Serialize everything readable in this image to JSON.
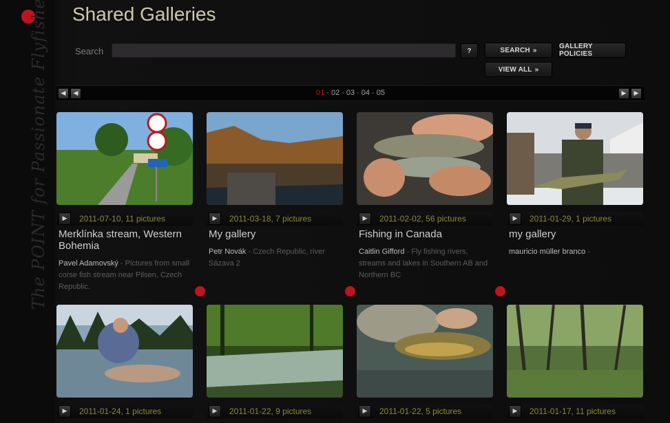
{
  "page": {
    "title": "Shared Galleries",
    "tagline": "The POINT for Passionate Flyfishers"
  },
  "search": {
    "label": "Search",
    "value": "",
    "placeholder": "",
    "help_label": "?",
    "search_label": "SEARCH",
    "policies_label": "GALLERY POLICIES",
    "view_all_label": "VIEW ALL"
  },
  "pager": {
    "pages": [
      "01",
      "02",
      "03",
      "04",
      "05"
    ],
    "current": "01"
  },
  "colors": {
    "accent_red": "#c1121f",
    "title_gold": "#cfc8ae",
    "meta_olive": "#8c8a3a"
  },
  "galleries": [
    {
      "meta": "2011-07-10, 11 pictures",
      "title": "Merklínka stream, Western Bohemia",
      "author": "Pavel Adamovský",
      "desc": " - Pictures from small corse fish stream near Pilsen, Czech Republic."
    },
    {
      "meta": "2011-03-18, 7 pictures",
      "title": "My gallery",
      "author": "Petr Novák",
      "desc": " - Czech Republic, river Sázava 2"
    },
    {
      "meta": "2011-02-02, 56 pictures",
      "title": "Fishing in Canada",
      "author": "Caitlin Gifford",
      "desc": " - Fly fishing rivers, streams and lakes in Southern AB and Northern BC"
    },
    {
      "meta": "2011-01-29, 1 pictures",
      "title": "my gallery",
      "author": "mauricio müller branco",
      "desc": " -"
    },
    {
      "meta": "2011-01-24, 1 pictures",
      "title": "",
      "author": "",
      "desc": ""
    },
    {
      "meta": "2011-01-22, 9 pictures",
      "title": "",
      "author": "",
      "desc": ""
    },
    {
      "meta": "2011-01-22, 5 pictures",
      "title": "",
      "author": "",
      "desc": ""
    },
    {
      "meta": "2011-01-17, 11 pictures",
      "title": "",
      "author": "",
      "desc": ""
    }
  ]
}
